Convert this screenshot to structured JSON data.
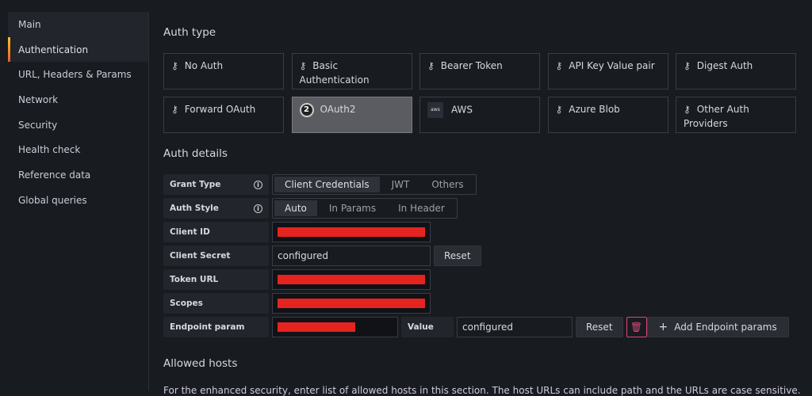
{
  "sidebar": {
    "items": [
      "Main",
      "Authentication",
      "URL, Headers & Params",
      "Network",
      "Security",
      "Health check",
      "Reference data",
      "Global queries"
    ]
  },
  "auth_type": {
    "title": "Auth type",
    "options": [
      {
        "label": "No Auth",
        "icon": "key-icon"
      },
      {
        "label": "Basic Authentication",
        "icon": "key-icon"
      },
      {
        "label": "Bearer Token",
        "icon": "key-icon"
      },
      {
        "label": "API Key Value pair",
        "icon": "key-icon"
      },
      {
        "label": "Digest Auth",
        "icon": "key-icon"
      },
      {
        "label": "Forward OAuth",
        "icon": "key-icon"
      },
      {
        "label": "OAuth2",
        "icon": "oauth2-icon"
      },
      {
        "label": "AWS",
        "icon": "aws-icon"
      },
      {
        "label": "Azure Blob",
        "icon": "key-icon"
      },
      {
        "label": "Other Auth Providers",
        "icon": "key-icon"
      }
    ],
    "selected": "OAuth2"
  },
  "auth_details": {
    "title": "Auth details",
    "grant_type": {
      "label": "Grant Type",
      "options": [
        "Client Credentials",
        "JWT",
        "Others"
      ],
      "selected": "Client Credentials"
    },
    "auth_style": {
      "label": "Auth Style",
      "options": [
        "Auto",
        "In Params",
        "In Header"
      ],
      "selected": "Auto"
    },
    "client_id": {
      "label": "Client ID"
    },
    "client_secret": {
      "label": "Client Secret",
      "value": "configured",
      "reset": "Reset"
    },
    "token_url": {
      "label": "Token URL"
    },
    "scopes": {
      "label": "Scopes"
    },
    "endpoint_param": {
      "label": "Endpoint param",
      "value_label": "Value",
      "value": "configured",
      "reset": "Reset",
      "add": "Add Endpoint params"
    }
  },
  "allowed_hosts": {
    "title": "Allowed hosts",
    "description": "For the enhanced security, enter list of allowed hosts in this section. The host URLs can include path and the URLs are case sensitive."
  },
  "colors": {
    "accent": "#f05a28",
    "redaction": "#e5231f",
    "danger": "#e0457b"
  }
}
